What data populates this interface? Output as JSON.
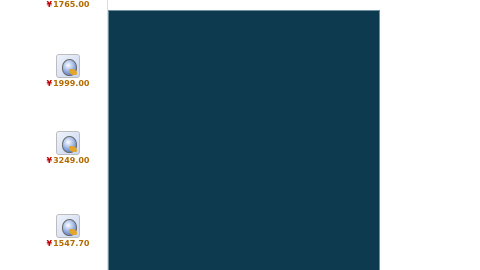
{
  "listings": [
    {
      "title": "",
      "price": "1765.00",
      "sub": "",
      "server": ""
    },
    {
      "title": "",
      "price": "1999.00",
      "sub": "",
      "server": ""
    },
    {
      "title": "",
      "price": "3249.00",
      "sub": "",
      "server": ""
    },
    {
      "title": "",
      "price": "1547.70",
      "sub": "",
      "server": ""
    }
  ],
  "top_partial": {
    "title": "",
    "price": "1765.00",
    "sub": "",
    "server": ""
  },
  "tooltip": {
    "lines": [
      {
        "text": "",
        "color": "white"
      },
      {
        "text": "",
        "color": "white"
      },
      {
        "text": "",
        "color": "white"
      },
      {
        "text": "",
        "color": "white"
      },
      {
        "text": "",
        "color": "white"
      },
      {
        "text": "",
        "color": "cyan"
      },
      {
        "text": "",
        "color": "cyan"
      },
      {
        "text": "",
        "color": "cyan"
      },
      {
        "text": "",
        "color": "green"
      },
      {
        "text": "",
        "color": "green"
      },
      {
        "text": "",
        "color": "green"
      },
      {
        "text": "",
        "color": "green"
      },
      {
        "text": "",
        "color": "green"
      },
      {
        "text": "",
        "color": "green"
      },
      {
        "text": "",
        "color": "green"
      },
      {
        "text": "",
        "color": "green"
      },
      {
        "text": "",
        "color": "green"
      },
      {
        "text": "",
        "color": "green"
      },
      {
        "text": "",
        "color": "purple"
      },
      {
        "text": "",
        "color": "lightblue"
      },
      {
        "text": "",
        "color": "lightblue"
      },
      {
        "text": "",
        "color": "pink"
      },
      {
        "text": "",
        "color": "yellow"
      },
      {
        "text": "",
        "color": "yellow"
      }
    ]
  },
  "colors": {
    "price_yuan": "#c00000",
    "tooltip_bg": "#0e3a4f",
    "stat_green": "#39d35a",
    "special_cyan": "#5fd0f0"
  }
}
